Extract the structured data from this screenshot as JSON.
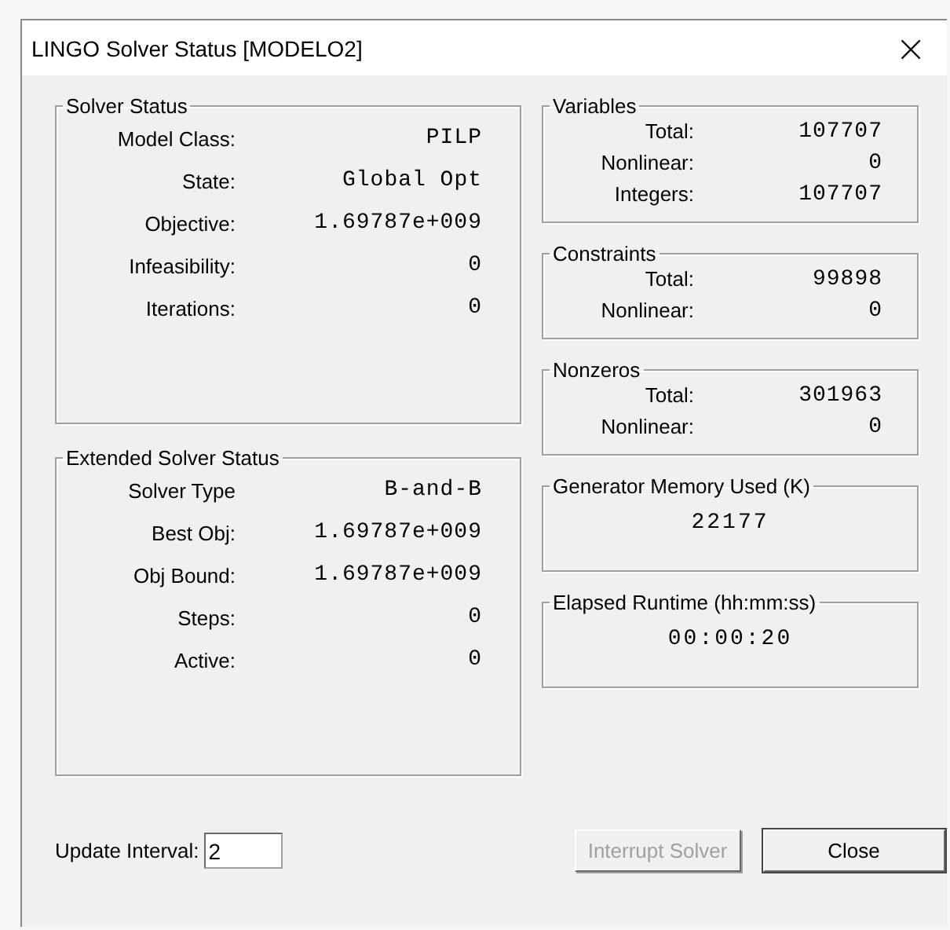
{
  "window": {
    "title": "LINGO Solver Status [MODELO2]",
    "close": "×"
  },
  "left_groups": [
    {
      "title": "Solver Status",
      "rows": [
        {
          "label": "Model Class:",
          "value": "PILP"
        },
        {
          "label": "State:",
          "value": "Global Opt"
        },
        {
          "label": "Objective:",
          "value": "1.69787e+009"
        },
        {
          "label": "Infeasibility:",
          "value": "0"
        },
        {
          "label": "Iterations:",
          "value": "0"
        }
      ]
    },
    {
      "title": "Extended Solver Status",
      "rows": [
        {
          "label": "Solver Type",
          "value": "B-and-B"
        },
        {
          "label": "Best Obj:",
          "value": "1.69787e+009"
        },
        {
          "label": "Obj Bound:",
          "value": "1.69787e+009"
        },
        {
          "label": "Steps:",
          "value": "0"
        },
        {
          "label": "Active:",
          "value": "0"
        }
      ]
    }
  ],
  "right_groups": [
    {
      "kind": "rows",
      "title": "Variables",
      "rows": [
        {
          "label": "Total:",
          "value": "107707"
        },
        {
          "label": "Nonlinear:",
          "value": "0"
        },
        {
          "label": "Integers:",
          "value": "107707"
        }
      ]
    },
    {
      "kind": "rows",
      "title": "Constraints",
      "rows": [
        {
          "label": "Total:",
          "value": "99898"
        },
        {
          "label": "Nonlinear:",
          "value": "0"
        }
      ]
    },
    {
      "kind": "rows",
      "title": "Nonzeros",
      "rows": [
        {
          "label": "Total:",
          "value": "301963"
        },
        {
          "label": "Nonlinear:",
          "value": "0"
        }
      ]
    },
    {
      "kind": "single",
      "title": "Generator Memory Used (K)",
      "value": "22177"
    },
    {
      "kind": "single",
      "title": "Elapsed Runtime (hh:mm:ss)",
      "value": "00:00:20"
    }
  ],
  "update_interval": {
    "label": "Update Interval:",
    "value": "2"
  },
  "buttons": [
    {
      "label": "Interrupt Solver",
      "disabled": true
    },
    {
      "label": "Close",
      "disabled": false
    }
  ]
}
